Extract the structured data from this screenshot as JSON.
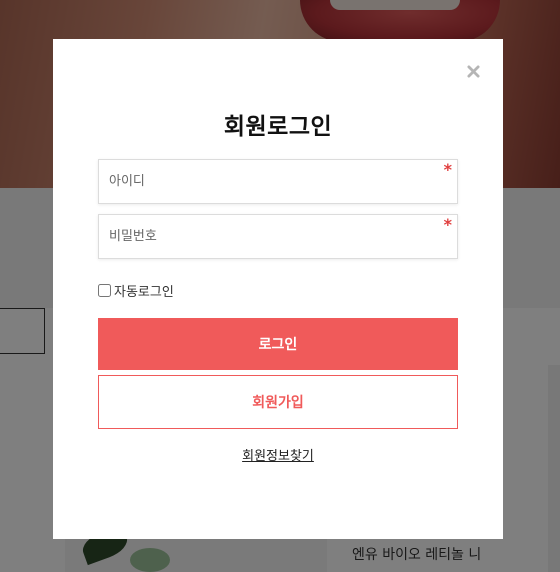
{
  "background": {
    "product_text": "엔유 바이오 레티놀 니"
  },
  "modal": {
    "title": "회원로그인",
    "close_icon": "close-icon",
    "id_field": {
      "placeholder": "아이디",
      "required_mark": "*"
    },
    "password_field": {
      "placeholder": "비밀번호",
      "required_mark": "*"
    },
    "auto_login_label": "자동로그인",
    "login_button": "로그인",
    "join_button": "회원가입",
    "find_link": "회원정보찾기"
  },
  "colors": {
    "accent": "#f05a5a",
    "overlay": "rgba(0,0,0,0.5)"
  }
}
